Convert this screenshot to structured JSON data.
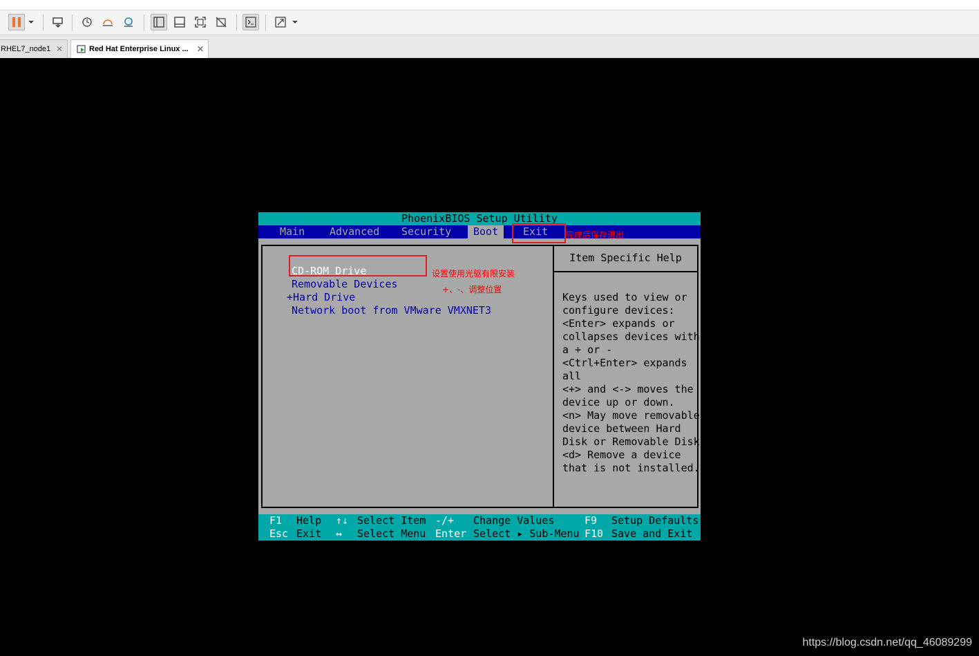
{
  "tabs": [
    {
      "label": "RHEL7_node1"
    },
    {
      "label": "Red Hat Enterprise Linux ..."
    }
  ],
  "bios": {
    "title": "PhoenixBIOS Setup Utility",
    "menu": [
      "Main",
      "Advanced",
      "Security",
      "Boot",
      "Exit"
    ],
    "active_menu": "Boot",
    "boot_items": [
      "CD-ROM Drive",
      "Removable Devices",
      "+Hard Drive",
      "Network boot from VMware VMXNET3"
    ],
    "help_title": "Item Specific Help",
    "help_lines": [
      "Keys used to view or",
      "configure devices:",
      "<Enter> expands or",
      "collapses devices with",
      "a + or -",
      "<Ctrl+Enter> expands",
      "all",
      "<+> and <-> moves the",
      "device up or down.",
      "<n> May move removable",
      "device between Hard",
      "Disk or Removable Disk",
      "<d> Remove a device",
      "that is not installed."
    ],
    "footer": {
      "row1": {
        "k1": "F1",
        "d1": "Help",
        "k2": "↑↓",
        "d2": "Select Item",
        "k3": "-/+",
        "d3": "Change Values",
        "k4": "F9",
        "d4": "Setup Defaults"
      },
      "row2": {
        "k1": "Esc",
        "d1": "Exit",
        "k2": "↔",
        "d2": "Select Menu",
        "k3": "Enter",
        "d3": "Select ▸ Sub-Menu",
        "k4": "F10",
        "d4": "Save and Exit"
      }
    }
  },
  "annotations": {
    "exit_note": "完成后保存退出",
    "cdrom_note": "设置使用光驱有限安装",
    "move_note": "+、-、调整位置"
  },
  "watermark": "https://blog.csdn.net/qq_46089299",
  "colors": {
    "bios_cyan": "#00a8a8",
    "bios_blue": "#0000a8",
    "bios_gray": "#a8a8a8",
    "annotation_red": "#e02020",
    "pause_orange": "#e8742f"
  }
}
